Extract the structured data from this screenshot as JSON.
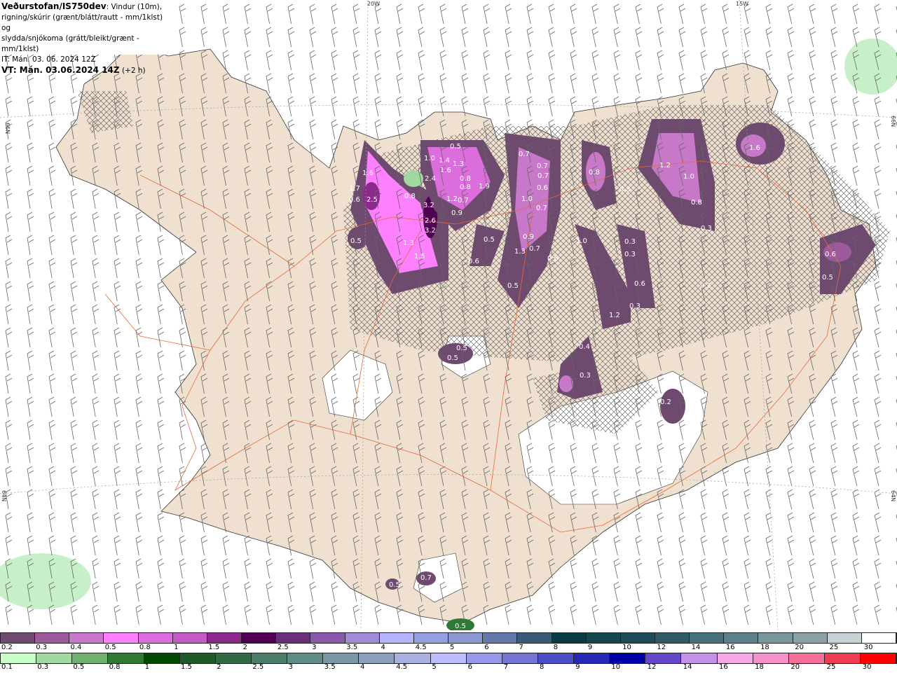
{
  "header": {
    "source": "Veðurstofan/IS750dev",
    "description_line1": ": Vindur (10m),",
    "description_line2": "rigning/skúrir (grænt/blátt/rautt - mm/1klst) og",
    "description_line3": "slydda/snjókoma (grátt/bleikt/grænt - mm/1klst)",
    "issue_time": "IT: Mán. 03. 06. 2024 12Z",
    "valid_time": "VT: Mán. 03.06.2024 14Z",
    "lead_time": "(+2 h)"
  },
  "map": {
    "grid_labels": {
      "lon1": "20W",
      "lon2": "15W",
      "lat_left_top": "66N",
      "lat_left_bottom": "64N",
      "lat_right_top": "66N",
      "lat_right_bottom": "64N"
    },
    "value_labels": [
      "1.6",
      "1.7",
      "0.6",
      "2.5",
      "0.5",
      "0.8",
      "3.2",
      "2.6",
      "3.2",
      "1.3",
      "1.5",
      "1.0",
      "2.4",
      "1.4",
      "1.6",
      "1.3",
      "0.5",
      "0.8",
      "0.8",
      "1.9",
      "1.2",
      "0.7",
      "0.9",
      "0.7",
      "0.5",
      "0.6",
      "0.7",
      "0.7",
      "0.7",
      "0.6",
      "1.0",
      "0.7",
      "0.9",
      "0.7",
      "1.3",
      "0.6",
      "0.5",
      "0.8",
      "0.3",
      "1.0",
      "0.3",
      "0.3",
      "0.6",
      "0.3",
      "1.2",
      "1.2",
      "1.0",
      "0.8",
      "0.3",
      "1.6",
      "0.2",
      "0.6",
      "0.5",
      "0.5",
      "0.5",
      "0.4",
      "0.3",
      "0.2",
      "0.7",
      "0.5",
      "0.5"
    ],
    "colors": {
      "land": "#f0e0d0",
      "sea": "#ffffff",
      "roads": "#e8683a",
      "precip_light": "#6e4a6e",
      "precip_mid": "#ff80ff",
      "precip_heavy": "#500050",
      "rain_light": "#c8ffc8"
    }
  },
  "legend": {
    "snow_scale": {
      "labels": [
        "0.2",
        "0.3",
        "0.4",
        "0.5",
        "0.8",
        "1",
        "1.5",
        "2",
        "2.5",
        "3",
        "3.5",
        "4",
        "4.5",
        "5",
        "6",
        "7",
        "8",
        "9",
        "10",
        "12",
        "14",
        "16",
        "18",
        "20",
        "25",
        "30"
      ],
      "colors": [
        "#6e4a6e",
        "#9c5a9c",
        "#c878c8",
        "#ff80ff",
        "#dc6ddc",
        "#c45ac4",
        "#8c2a8c",
        "#500050",
        "#6a2f7a",
        "#8a5aaa",
        "#a08cd4",
        "#b4b4ff",
        "#96a0e0",
        "#8c96d0",
        "#6478aa",
        "#3c5a78",
        "#0a3c46",
        "#144650",
        "#1e4c58",
        "#325a64",
        "#46707a",
        "#5a8288",
        "#78969c",
        "#8ca2a8",
        "#c8d0d4",
        "#ffffff"
      ]
    },
    "rain_scale": {
      "labels": [
        "0.1",
        "0.3",
        "0.5",
        "0.8",
        "1",
        "1.5",
        "2",
        "2.5",
        "3",
        "3.5",
        "4",
        "4.5",
        "5",
        "6",
        "7",
        "8",
        "9",
        "10",
        "12",
        "14",
        "16",
        "18",
        "20",
        "25",
        "30"
      ],
      "colors": [
        "#c8ffc8",
        "#a0d8a0",
        "#70b070",
        "#2e7a32",
        "#004800",
        "#1e5a28",
        "#306a44",
        "#4a7e68",
        "#608a86",
        "#7898a8",
        "#8ca0c0",
        "#a8b0e0",
        "#bcbcff",
        "#9898e8",
        "#7474d8",
        "#4c4cc8",
        "#2828b8",
        "#0000a8",
        "#6448c8",
        "#c490e8",
        "#f4a8e8",
        "#f690c8",
        "#f47098",
        "#f03c50",
        "#ff0000"
      ]
    }
  }
}
